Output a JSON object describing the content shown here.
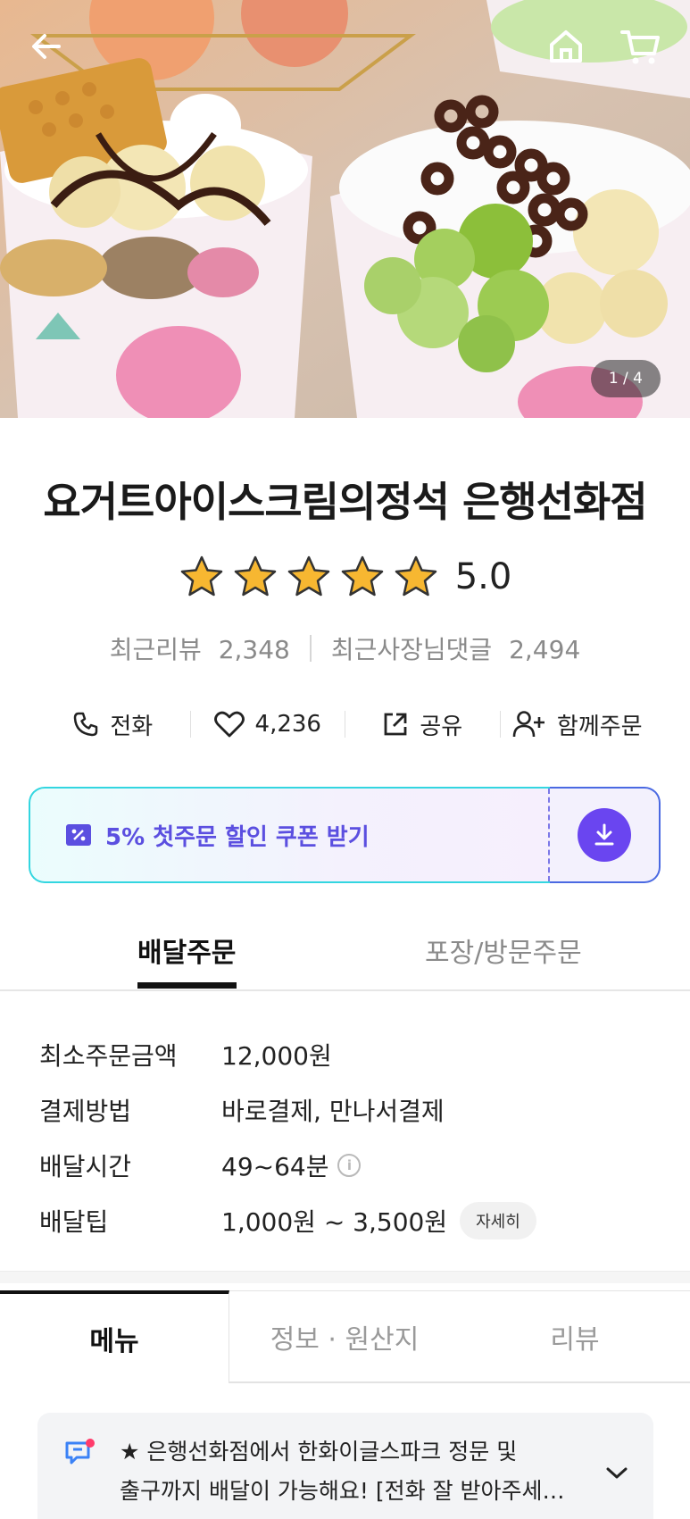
{
  "hero": {
    "page_counter": "1 / 4",
    "back_icon": "arrow-left-icon",
    "home_icon": "home-icon",
    "cart_icon": "cart-icon"
  },
  "store": {
    "name": "요거트아이스크림의정석 은행선화점",
    "rating": 5.0,
    "rating_text": "5.0",
    "stars_total": 5,
    "recent_reviews_label": "최근리뷰",
    "recent_reviews_count": "2,348",
    "owner_replies_label": "최근사장님댓글",
    "owner_replies_count": "2,494"
  },
  "actions": {
    "call_label": "전화",
    "like_count": "4,236",
    "share_label": "공유",
    "group_order_label": "함께주문"
  },
  "coupon": {
    "label": "5% 첫주문 할인 쿠폰 받기"
  },
  "order_tabs": {
    "delivery": "배달주문",
    "pickup": "포장/방문주문"
  },
  "info": {
    "min_order_key": "최소주문금액",
    "min_order_val": "12,000원",
    "payment_key": "결제방법",
    "payment_val": "바로결제, 만나서결제",
    "delivery_time_key": "배달시간",
    "delivery_time_val": "49~64분",
    "delivery_tip_key": "배달팁",
    "delivery_tip_val": "1,000원 ~ 3,500원",
    "detail_button": "자세히"
  },
  "content_tabs": {
    "menu": "메뉴",
    "info_origin": "정보 · 원산지",
    "review": "리뷰"
  },
  "notice": {
    "line1": "★ 은행선화점에서 한화이글스파크 정문 및",
    "line2": "출구까지 배달이 가능해요! [전화 잘 받아주세…"
  },
  "colors": {
    "star": "#f7b731",
    "coupon_text": "#5b4fe0",
    "coupon_button": "#6a45f0",
    "tab_active": "#111111"
  }
}
